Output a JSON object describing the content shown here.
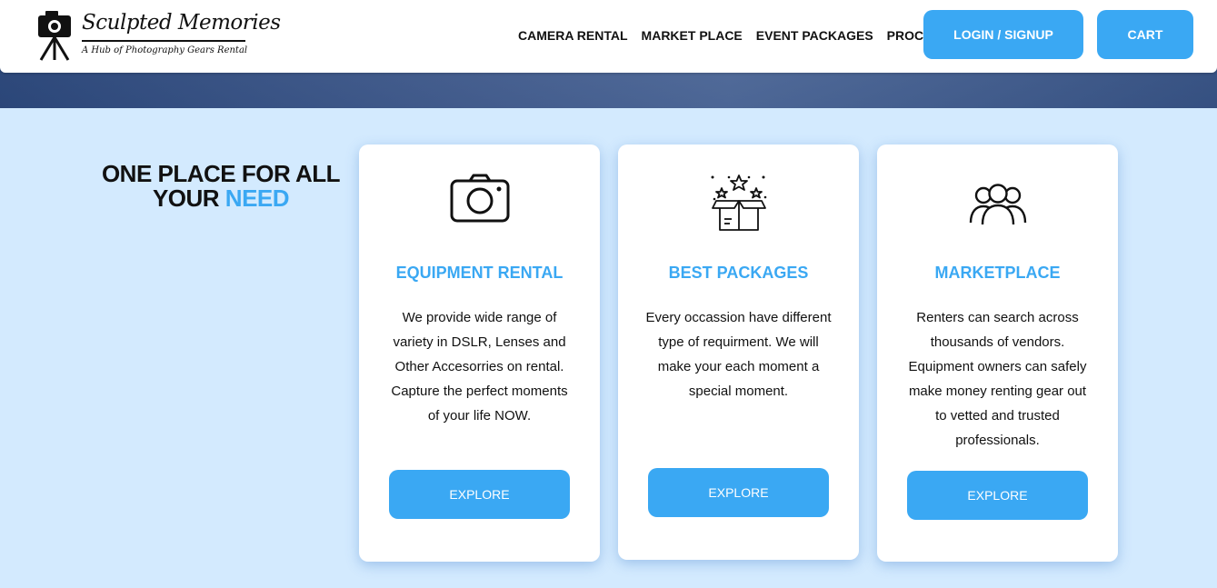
{
  "header": {
    "logo_title": "Sculpted Memories",
    "logo_tagline": "A Hub of Photography Gears Rental",
    "nav": [
      "CAMERA RENTAL",
      "MARKET PLACE",
      "EVENT PACKAGES",
      "PROCESS"
    ],
    "login_label": "LOGIN / SIGNUP",
    "cart_label": "CART"
  },
  "headline": {
    "line1_a": "ONE PLACE FOR ",
    "line1_b": "ALL",
    "line2_a": "YOUR ",
    "line2_b": "NEED"
  },
  "cards": [
    {
      "icon": "camera-icon",
      "title": "EQUIPMENT RENTAL",
      "text": "We provide wide range of variety in DSLR, Lenses and Other Accesorries on rental. Capture the perfect moments of your life NOW.",
      "button": "EXPLORE"
    },
    {
      "icon": "gift-box-icon",
      "title": "BEST PACKAGES",
      "text": "Every occassion have different type of requirment. We will make your each moment a special moment.",
      "button": "EXPLORE"
    },
    {
      "icon": "people-group-icon",
      "title": "MARKETPLACE",
      "text": "Renters can search across thousands of vendors. Equipment owners can safely make money renting gear out to vetted and trusted professionals.",
      "button": "EXPLORE"
    }
  ],
  "colors": {
    "accent": "#3aa8f3",
    "section_bg": "#d3eafe",
    "text": "#111111"
  }
}
